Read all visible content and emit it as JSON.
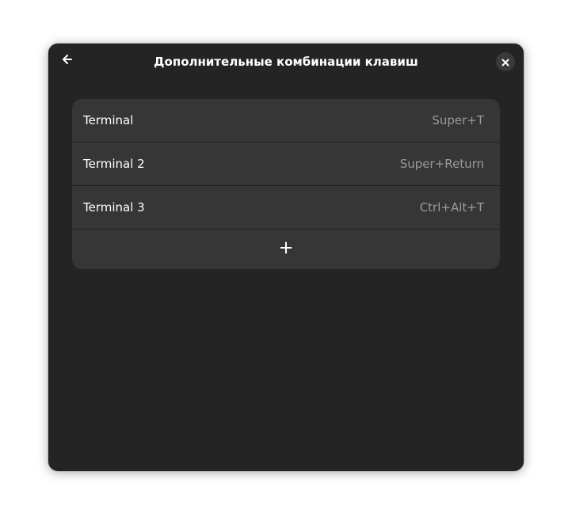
{
  "window": {
    "title": "Дополнительные комбинации клавиш"
  },
  "header": {
    "back_icon": "go-back-arrow-icon",
    "close_icon": "close-x-icon"
  },
  "shortcuts": [
    {
      "name": "Terminal",
      "accelerator": "Super+T"
    },
    {
      "name": "Terminal 2",
      "accelerator": "Super+Return"
    },
    {
      "name": "Terminal 3",
      "accelerator": "Ctrl+Alt+T"
    }
  ],
  "add_button": {
    "icon": "plus-icon"
  },
  "colors": {
    "window_bg": "#242424",
    "list_bg": "#363636",
    "text": "#ffffff",
    "dim_text": "#9a9a9a"
  }
}
